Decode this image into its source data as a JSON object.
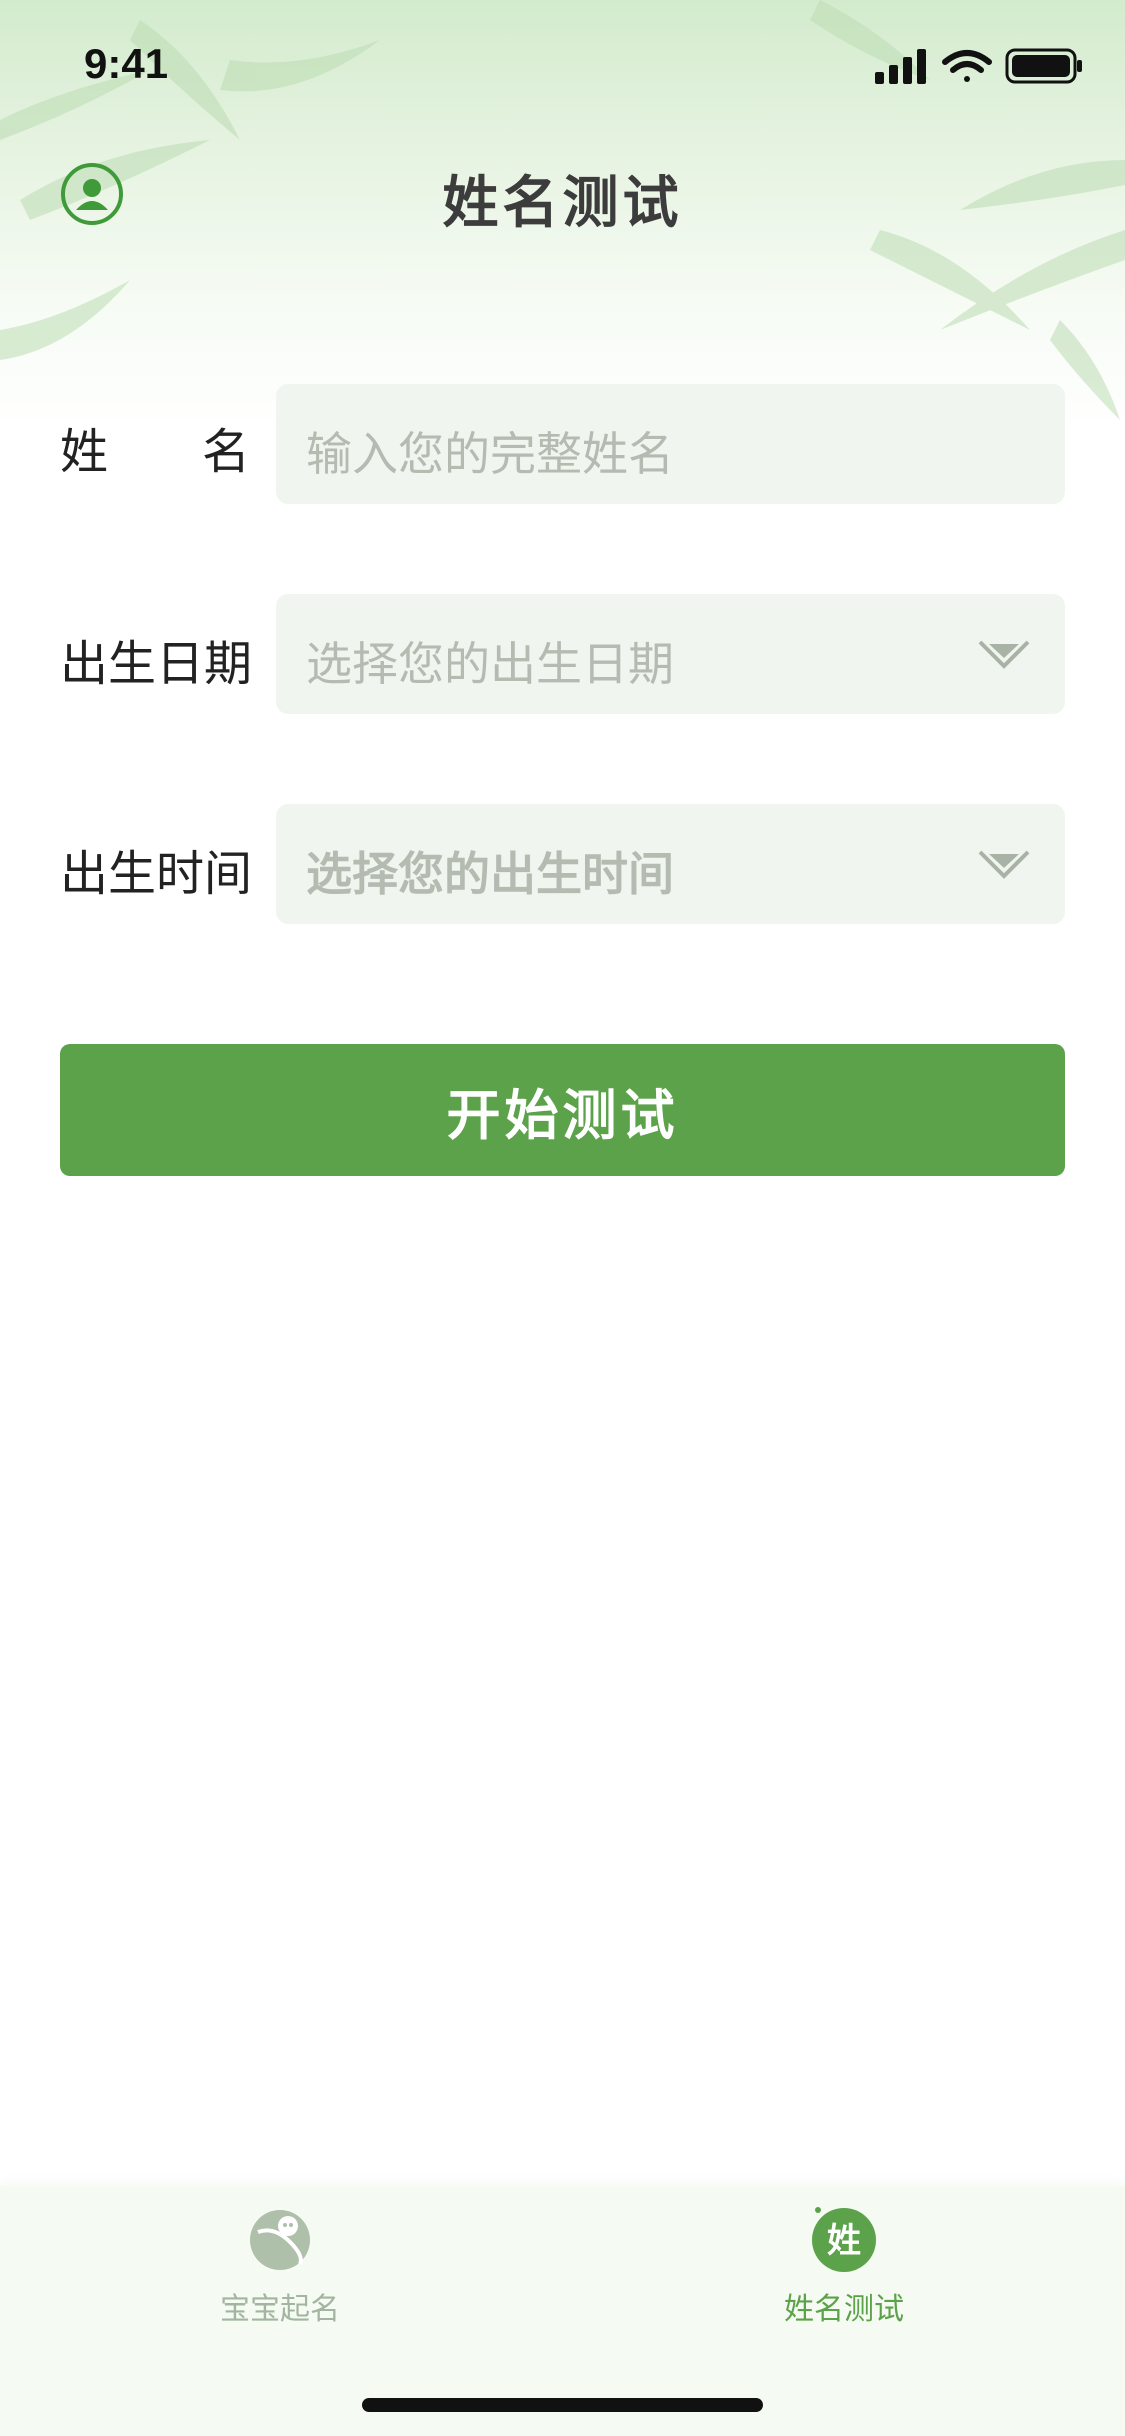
{
  "status_bar": {
    "time": "9:41"
  },
  "header": {
    "title": "姓名测试"
  },
  "form": {
    "name": {
      "label_chars": [
        "姓",
        "名"
      ],
      "placeholder": "输入您的完整姓名"
    },
    "birth_date": {
      "label": "出生日期",
      "placeholder": "选择您的出生日期"
    },
    "birth_time": {
      "label": "出生时间",
      "placeholder": "选择您的出生时间"
    }
  },
  "start_button": {
    "label": "开始测试"
  },
  "tab_bar": {
    "items": [
      {
        "label": "宝宝起名",
        "icon": "baby-naming-icon",
        "active": false
      },
      {
        "label": "姓名测试",
        "icon": "name-test-icon",
        "icon_char": "姓",
        "active": true
      }
    ]
  },
  "colors": {
    "accent": "#5ca24a",
    "field_bg": "#f1f5ef",
    "placeholder": "#b4bcb2"
  }
}
